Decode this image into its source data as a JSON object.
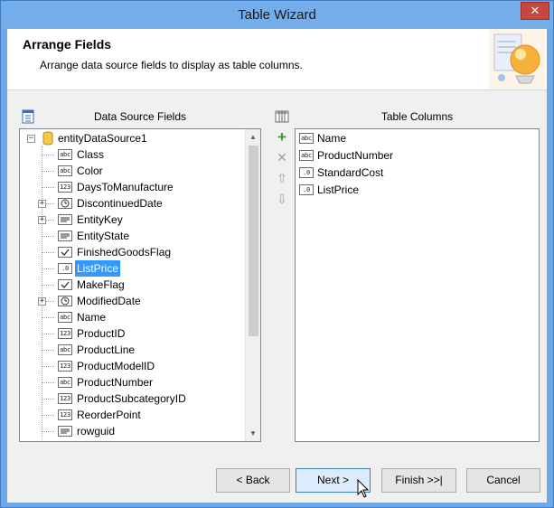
{
  "window": {
    "title": "Table Wizard",
    "close_glyph": "✕"
  },
  "header": {
    "title": "Arrange Fields",
    "subtitle": "Arrange data source fields to display as table columns."
  },
  "left_panel": {
    "title": "Data Source Fields",
    "icon": "list-icon"
  },
  "right_panel": {
    "title": "Table Columns",
    "icon": "table-icon"
  },
  "tree": {
    "root": {
      "label": "entityDataSource1",
      "expander": "−",
      "icon": "database-icon"
    },
    "items": [
      {
        "label": "Class",
        "icon": "abc",
        "expander": ""
      },
      {
        "label": "Color",
        "icon": "abc",
        "expander": ""
      },
      {
        "label": "DaysToManufacture",
        "icon": "123",
        "expander": ""
      },
      {
        "label": "DiscontinuedDate",
        "icon": "clock",
        "expander": "+"
      },
      {
        "label": "EntityKey",
        "icon": "key",
        "expander": "+"
      },
      {
        "label": "EntityState",
        "icon": "key",
        "expander": ""
      },
      {
        "label": "FinishedGoodsFlag",
        "icon": "check",
        "expander": ""
      },
      {
        "label": "ListPrice",
        "icon": ".0",
        "expander": "",
        "selected": true
      },
      {
        "label": "MakeFlag",
        "icon": "check",
        "expander": ""
      },
      {
        "label": "ModifiedDate",
        "icon": "clock",
        "expander": "+"
      },
      {
        "label": "Name",
        "icon": "abc",
        "expander": ""
      },
      {
        "label": "ProductID",
        "icon": "123",
        "expander": ""
      },
      {
        "label": "ProductLine",
        "icon": "abc",
        "expander": ""
      },
      {
        "label": "ProductModelID",
        "icon": "123",
        "expander": ""
      },
      {
        "label": "ProductNumber",
        "icon": "abc",
        "expander": ""
      },
      {
        "label": "ProductSubcategoryID",
        "icon": "123",
        "expander": ""
      },
      {
        "label": "ReorderPoint",
        "icon": "123",
        "expander": ""
      },
      {
        "label": "rowguid",
        "icon": "key",
        "expander": ""
      }
    ]
  },
  "columns": [
    {
      "label": "Name",
      "icon": "abc"
    },
    {
      "label": "ProductNumber",
      "icon": "abc"
    },
    {
      "label": "StandardCost",
      "icon": ".0"
    },
    {
      "label": "ListPrice",
      "icon": ".0"
    }
  ],
  "side_buttons": {
    "add": "+",
    "remove": "✕",
    "up": "⇧",
    "down": "⇩"
  },
  "scroll": {
    "up": "▲",
    "down": "▼"
  },
  "buttons": {
    "back": "< Back",
    "next": "Next >",
    "finish": "Finish >>|",
    "cancel": "Cancel"
  },
  "colors": {
    "selection": "#3399ff",
    "add_green": "#3a9a2a"
  }
}
